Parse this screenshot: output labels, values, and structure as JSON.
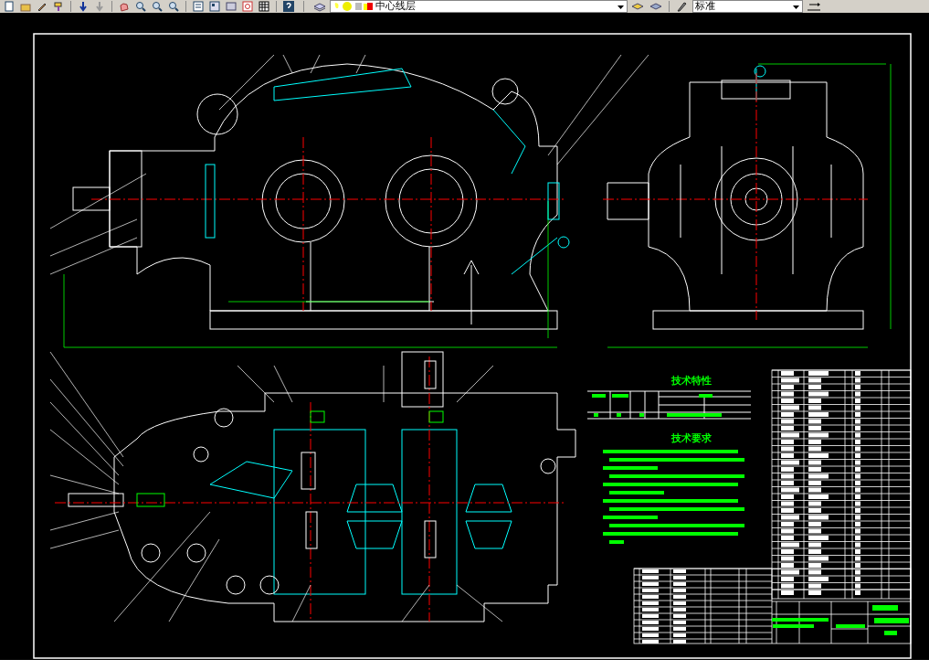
{
  "toolbar": {
    "layer_dropdown": {
      "value": "中心线层"
    },
    "style_dropdown": {
      "value": "标准"
    }
  },
  "drawing": {
    "tech_specs_title": "技术特性",
    "tech_requirements_title": "技术要求"
  }
}
